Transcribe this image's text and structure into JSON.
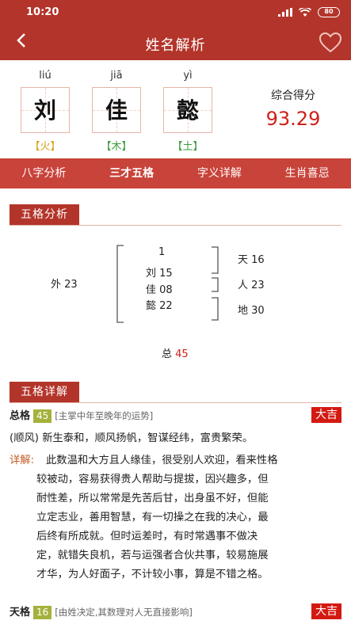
{
  "status": {
    "time": "10:20",
    "battery": "80"
  },
  "nav": {
    "title": "姓名解析"
  },
  "name": [
    {
      "pinyin": "liú",
      "char": "刘",
      "element": "【火】",
      "color": "#d8a21a"
    },
    {
      "pinyin": "jiā",
      "char": "佳",
      "element": "【木】",
      "color": "#3c9a3c"
    },
    {
      "pinyin": "yì",
      "char": "懿",
      "element": "【土】",
      "color": "#3c9a3c"
    }
  ],
  "score": {
    "label": "综合得分",
    "value": "93.29"
  },
  "tabs": [
    "八字分析",
    "三才五格",
    "字义详解",
    "生肖喜忌"
  ],
  "wuge_section": {
    "title": "五格分析"
  },
  "wuge": {
    "top": "1",
    "chars": [
      "刘 15",
      "佳 08",
      "懿 22"
    ],
    "outer": "外 23",
    "heaven": "天 16",
    "person": "人 23",
    "earth": "地 30",
    "total_label": "总",
    "total_value": "45"
  },
  "detail_section": {
    "title": "五格详解"
  },
  "zongge": {
    "label": "总格",
    "num": "45",
    "desc": "[主掌中年至晚年的运势]",
    "luck": "大吉",
    "summary": "(顺风) 新生泰和，顺风扬帆，智谋经纬，富贵繁荣。",
    "detail_label": "详解:",
    "detail_lines": [
      "此数温和大方且人缘佳，很受别人欢迎，看来性格",
      "较被动，容易获得贵人帮助与提拔，因兴趣多，但",
      "耐性差，所以常常是先苦后甘，出身虽不好，但能",
      "立定志业，善用智慧，有一切操之在我的决心，最",
      "后终有所成就。但时运差时，有时常遇事不做决",
      "定，就错失良机，若与运强者合伙共事，较易施展",
      "才华，为人好面子，不计较小事，算是不错之格。"
    ]
  },
  "tiange": {
    "label": "天格",
    "num": "16",
    "desc": "[由姓决定,其数理对人无直接影响]",
    "luck": "大吉"
  }
}
